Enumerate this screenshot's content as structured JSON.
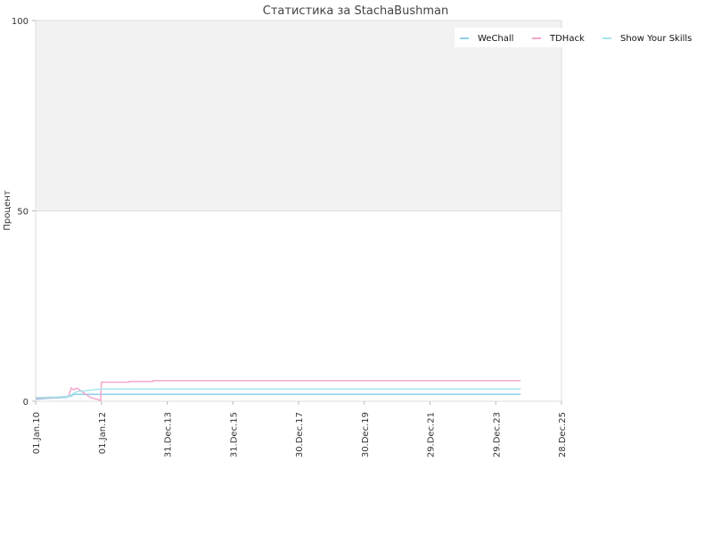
{
  "chart_data": {
    "type": "line",
    "title": "Статистика за StachaBushman",
    "xlabel": "",
    "ylabel": "Процент",
    "ylim": [
      0,
      100
    ],
    "y_ticks": [
      "0",
      "50",
      "100"
    ],
    "x_ticks": [
      "01.Jan.10",
      "01.Jan.12",
      "31.Dec.13",
      "31.Dec.15",
      "30.Dec.17",
      "30.Dec.19",
      "29.Dec.21",
      "29.Dec.23",
      "28.Dec.25"
    ],
    "x_tick_dates": [
      "2010-01-01",
      "2012-01-01",
      "2013-12-31",
      "2015-12-31",
      "2017-12-30",
      "2019-12-30",
      "2021-12-29",
      "2023-12-29",
      "2025-12-28"
    ],
    "xlim": [
      "2010-01-01",
      "2025-12-28"
    ],
    "grid": true,
    "shaded_band": [
      50,
      100
    ],
    "legend_position": "top-right",
    "colors": {
      "band": "#f2f2f2",
      "grid": "#dddddd",
      "axis": "#bbbbbb"
    },
    "series": [
      {
        "name": "WeChall",
        "color": "#8ecfec",
        "x": [
          "2010-01-01",
          "2010-06-01",
          "2010-12-01",
          "2011-01-01",
          "2011-02-01",
          "2011-03-01",
          "2024-10-01"
        ],
        "y": [
          0.5,
          0.8,
          1.0,
          1.2,
          1.4,
          1.8,
          1.8
        ]
      },
      {
        "name": "TDHack",
        "color": "#f4a6cc",
        "x": [
          "2010-01-01",
          "2010-08-01",
          "2010-12-01",
          "2011-01-01",
          "2011-02-01",
          "2011-03-01",
          "2011-04-01",
          "2011-06-01",
          "2011-09-01",
          "2011-12-25",
          "2012-01-01",
          "2012-11-01",
          "2012-11-02",
          "2013-08-01",
          "2013-08-02",
          "2024-10-01"
        ],
        "y": [
          0.8,
          1.0,
          1.2,
          1.4,
          3.5,
          3.0,
          3.5,
          2.5,
          1.0,
          0.2,
          5.0,
          5.0,
          5.2,
          5.2,
          5.4,
          5.4
        ]
      },
      {
        "name": "Show Your Skills",
        "color": "#a6e6ea",
        "x": [
          "2010-01-01",
          "2010-09-01",
          "2011-01-01",
          "2011-04-01",
          "2012-01-01",
          "2024-10-01"
        ],
        "y": [
          1.0,
          1.1,
          1.3,
          2.5,
          3.2,
          3.2
        ]
      }
    ]
  }
}
